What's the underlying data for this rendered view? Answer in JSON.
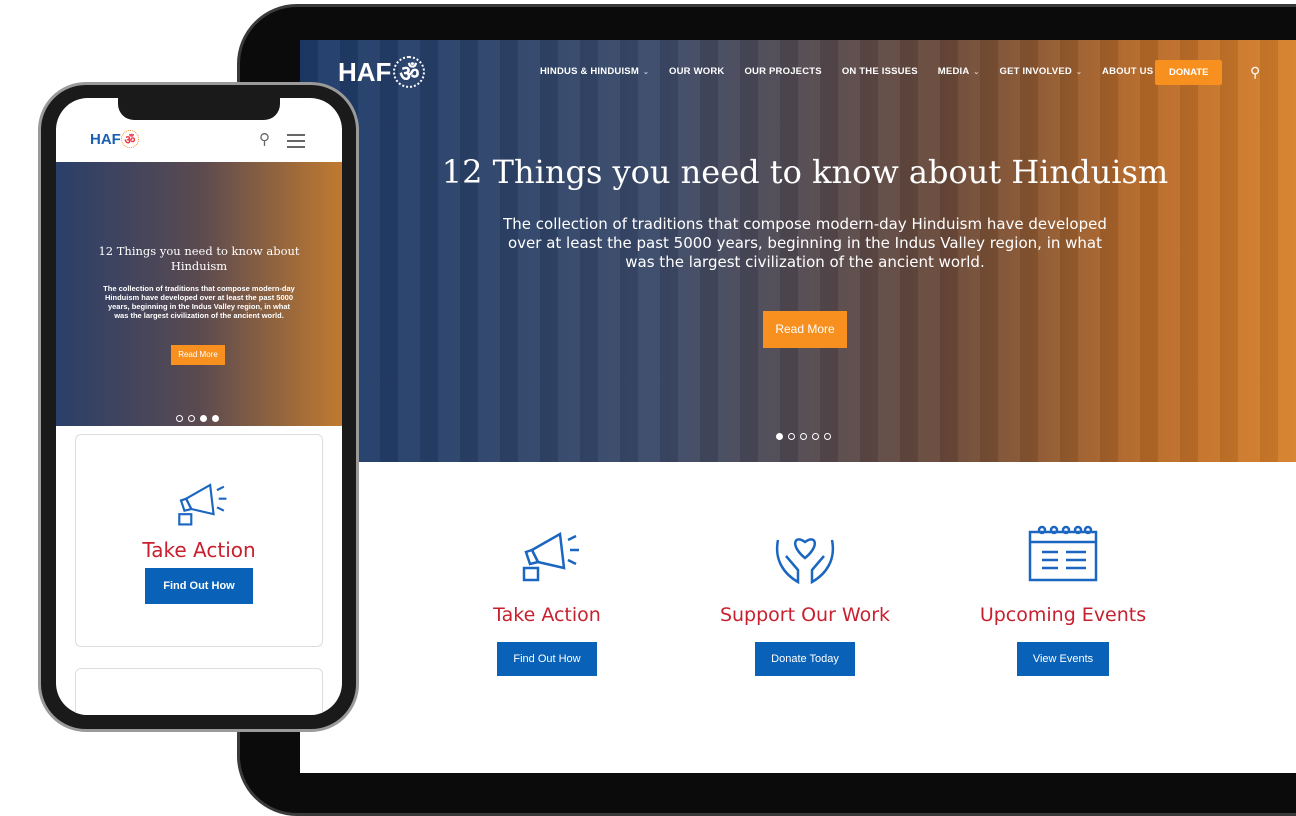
{
  "desktop": {
    "logo": "HAF",
    "nav": [
      {
        "label": "HINDUS & HINDUISM",
        "dropdown": true
      },
      {
        "label": "OUR WORK",
        "dropdown": false
      },
      {
        "label": "OUR PROJECTS",
        "dropdown": false
      },
      {
        "label": "ON THE ISSUES",
        "dropdown": false
      },
      {
        "label": "MEDIA",
        "dropdown": true
      },
      {
        "label": "GET INVOLVED",
        "dropdown": true
      },
      {
        "label": "ABOUT US",
        "dropdown": true
      }
    ],
    "donate": "DONATE",
    "hero": {
      "title": "12 Things you need to know about Hinduism",
      "text": "The collection of traditions that compose modern-day Hinduism have developed over at least the past 5000 years, beginning in the Indus Valley region, in what was the largest civilization of the ancient world.",
      "button": "Read More",
      "slides": 5,
      "active_slide": 1
    },
    "cards": [
      {
        "icon": "megaphone-icon",
        "title": "Take Action",
        "button": "Find Out How"
      },
      {
        "icon": "heart-hands-icon",
        "title": "Support Our Work",
        "button": "Donate Today"
      },
      {
        "icon": "calendar-icon",
        "title": "Upcoming Events",
        "button": "View Events"
      }
    ]
  },
  "mobile": {
    "logo": "HAF",
    "hero": {
      "title": "12 Things you need to know about Hinduism",
      "text": "The collection of traditions that compose modern-day Hinduism have developed over at least the past 5000 years, beginning in the Indus Valley region, in what was the largest civilization of the ancient world.",
      "button": "Read More",
      "slides": 4,
      "active_slides": [
        3,
        4
      ]
    },
    "card": {
      "title": "Take Action",
      "button": "Find Out How"
    }
  },
  "colors": {
    "accent": "#f7901e",
    "primary_button": "#0a62b8",
    "heading_red": "#c8202f"
  }
}
